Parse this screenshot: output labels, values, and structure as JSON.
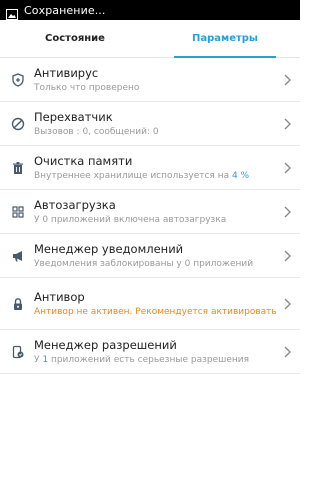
{
  "statusbar": {
    "title": "Сохранение..."
  },
  "tabs": [
    {
      "label": "Состояние"
    },
    {
      "label": "Параметры"
    }
  ],
  "items": [
    {
      "icon": "shield-plus-icon",
      "label": "Антивирус",
      "sub": "Только что проверено"
    },
    {
      "icon": "block-icon",
      "label": "Перехватчик",
      "sub": "Вызовов : 0, сообщений: 0"
    },
    {
      "icon": "trash-icon",
      "label": "Очистка памяти",
      "sub_prefix": "Внутреннее хранилище используется на ",
      "sub_accent": "4 %"
    },
    {
      "icon": "grid-icon",
      "label": "Автозагрузка",
      "sub": "У 0 приложений включена автозагрузка"
    },
    {
      "icon": "megaphone-icon",
      "label": "Менеджер уведомлений",
      "sub": "Уведомления заблокированы у 0 приложений"
    },
    {
      "icon": "lock-icon",
      "label": "Антивор",
      "sub": "Антивор не активен. Рекомендуется активировать"
    },
    {
      "icon": "phone-permission-icon",
      "label": "Менеджер разрешений",
      "sub_prefix": "У ",
      "sub_accent": "1",
      "sub_suffix": " приложений есть серьезные разрешения"
    }
  ],
  "colors": {
    "accent": "#2a9fd6",
    "warning": "#e88a1a",
    "statusbar": "#000000"
  }
}
